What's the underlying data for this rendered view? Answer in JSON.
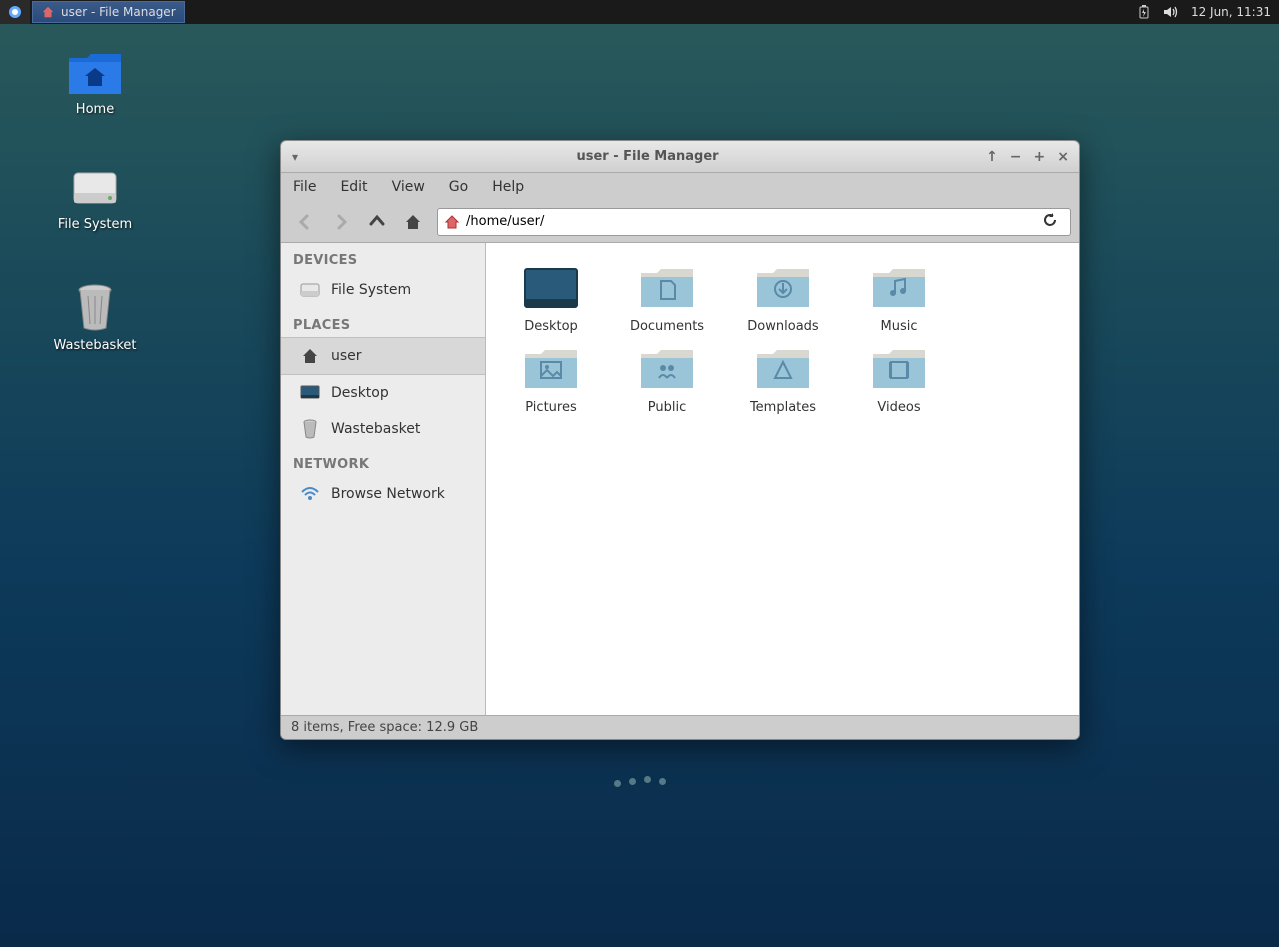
{
  "panel": {
    "task_label": "user - File Manager",
    "clock": "12 Jun, 11:31"
  },
  "desktop": {
    "icons": [
      {
        "label": "Home"
      },
      {
        "label": "File System"
      },
      {
        "label": "Wastebasket"
      }
    ]
  },
  "window": {
    "title": "user - File Manager",
    "menubar": [
      "File",
      "Edit",
      "View",
      "Go",
      "Help"
    ],
    "address": "/home/user/",
    "sidebar": {
      "cat_devices": "DEVICES",
      "cat_places": "PLACES",
      "cat_network": "NETWORK",
      "devices": [
        {
          "label": "File System"
        }
      ],
      "places": [
        {
          "label": "user",
          "active": true
        },
        {
          "label": "Desktop"
        },
        {
          "label": "Wastebasket"
        }
      ],
      "network": [
        {
          "label": "Browse Network"
        }
      ]
    },
    "files": [
      {
        "label": "Desktop",
        "kind": "desktop"
      },
      {
        "label": "Documents",
        "kind": "documents"
      },
      {
        "label": "Downloads",
        "kind": "downloads"
      },
      {
        "label": "Music",
        "kind": "music"
      },
      {
        "label": "Pictures",
        "kind": "pictures"
      },
      {
        "label": "Public",
        "kind": "public"
      },
      {
        "label": "Templates",
        "kind": "templates"
      },
      {
        "label": "Videos",
        "kind": "videos"
      }
    ],
    "status": "8 items, Free space: 12.9 GB"
  }
}
